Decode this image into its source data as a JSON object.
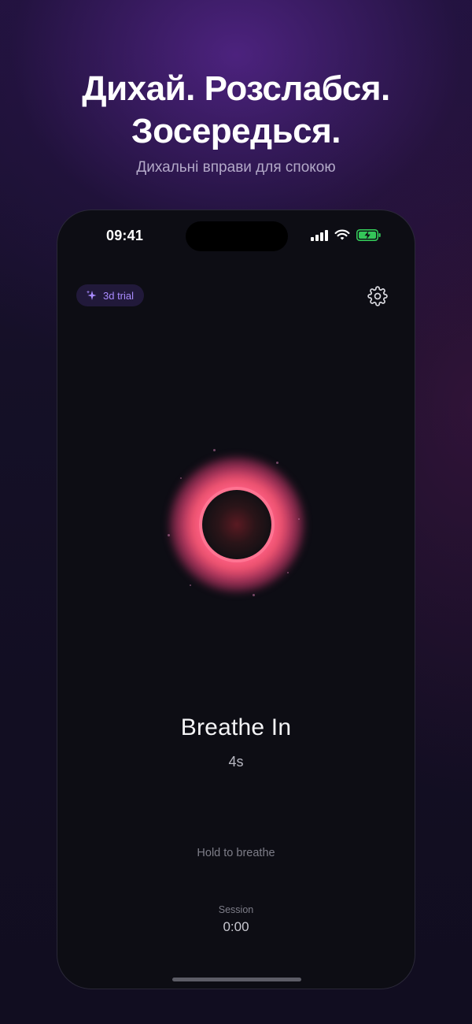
{
  "promo": {
    "headline_line1": "Дихай. Розслабся.",
    "headline_line2": "Зосередься.",
    "subtitle": "Дихальні вправи для спокою"
  },
  "status_bar": {
    "time": "09:41",
    "icons": [
      "signal-icon",
      "wifi-icon",
      "battery-charging-icon"
    ],
    "battery_color": "#34c759"
  },
  "header": {
    "trial_label": "3d trial",
    "trial_icon": "sparkle-icon",
    "settings_icon": "gear-icon",
    "accent": "#a98bff"
  },
  "breathing": {
    "phase": "Breathe In",
    "duration": "4s",
    "orb_color": "#ff5a86",
    "hint": "Hold to breathe"
  },
  "session": {
    "label": "Session",
    "value": "0:00"
  }
}
